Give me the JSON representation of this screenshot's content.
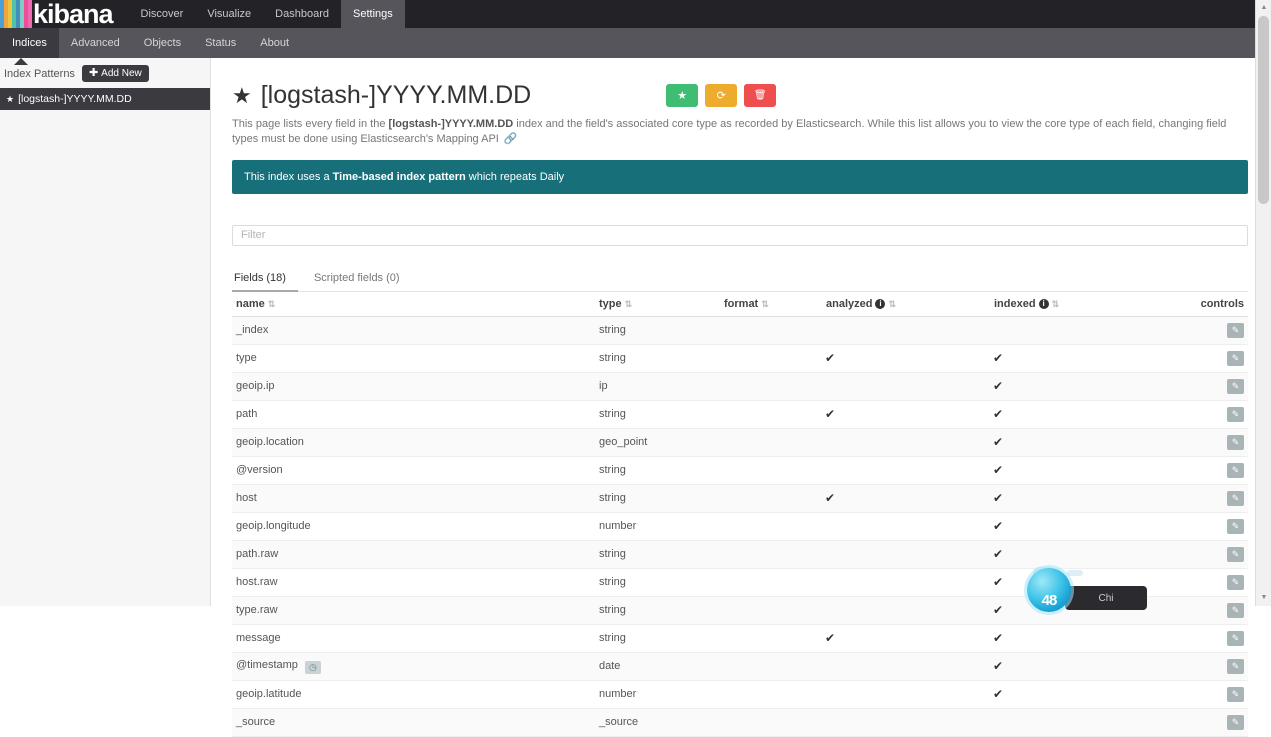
{
  "topnav": {
    "logo_text": "kibana",
    "logo_bar_colors": [
      "#4b9fd5",
      "#f2a33c",
      "#eac73e",
      "#55c1a9",
      "#3f8fbd",
      "#7ecfc0",
      "#ee4d9b",
      "#f06ab0"
    ],
    "items": [
      {
        "label": "Discover",
        "active": false
      },
      {
        "label": "Visualize",
        "active": false
      },
      {
        "label": "Dashboard",
        "active": false
      },
      {
        "label": "Settings",
        "active": true
      }
    ]
  },
  "subnav": {
    "items": [
      {
        "label": "Indices",
        "active": true
      },
      {
        "label": "Advanced",
        "active": false
      },
      {
        "label": "Objects",
        "active": false
      },
      {
        "label": "Status",
        "active": false
      },
      {
        "label": "About",
        "active": false
      }
    ]
  },
  "sidebar": {
    "heading": "Index Patterns",
    "add_new_label": "Add New",
    "add_new_icon": "plus-icon",
    "patterns": [
      {
        "label": "[logstash-]YYYY.MM.DD",
        "icon": "star-icon",
        "active": true
      }
    ]
  },
  "header": {
    "star_icon": "star-icon",
    "title": "[logstash-]YYYY.MM.DD",
    "actions": [
      {
        "name": "set-default-index-button",
        "icon": "★",
        "color": "#3fbe73"
      },
      {
        "name": "refresh-fields-button",
        "icon": "⟳",
        "color": "#eeac2e"
      },
      {
        "name": "delete-index-pattern-button",
        "icon": "🗑",
        "color": "#ef4e4e"
      }
    ],
    "description_pre": "This page lists every field in the ",
    "description_bold": "[logstash-]YYYY.MM.DD",
    "description_post": " index and the field's associated core type as recorded by Elasticsearch. While this list allows you to view the core type of each field, changing field types must be done using Elasticsearch's Mapping API ",
    "description_link_icon": "chain-icon",
    "alert_pre": "This index uses a ",
    "alert_bold": "Time-based index pattern",
    "alert_post": " which repeats Daily"
  },
  "filter": {
    "placeholder": "Filter",
    "value": ""
  },
  "tabs": [
    {
      "label": "Fields (18)",
      "active": true
    },
    {
      "label": "Scripted fields (0)",
      "active": false
    }
  ],
  "table": {
    "columns": [
      {
        "label": "name",
        "sortable": true,
        "info": false
      },
      {
        "label": "type",
        "sortable": true,
        "info": false
      },
      {
        "label": "format",
        "sortable": true,
        "info": false
      },
      {
        "label": "analyzed",
        "sortable": true,
        "info": true
      },
      {
        "label": "indexed",
        "sortable": true,
        "info": true
      },
      {
        "label": "controls",
        "sortable": false,
        "info": false
      }
    ],
    "check_glyph": "✔",
    "edit_icon": "✎",
    "rows": [
      {
        "name": "_index",
        "type": "string",
        "format": "",
        "analyzed": false,
        "indexed": false,
        "badge": null
      },
      {
        "name": "type",
        "type": "string",
        "format": "",
        "analyzed": true,
        "indexed": true,
        "badge": null
      },
      {
        "name": "geoip.ip",
        "type": "ip",
        "format": "",
        "analyzed": false,
        "indexed": true,
        "badge": null
      },
      {
        "name": "path",
        "type": "string",
        "format": "",
        "analyzed": true,
        "indexed": true,
        "badge": null
      },
      {
        "name": "geoip.location",
        "type": "geo_point",
        "format": "",
        "analyzed": false,
        "indexed": true,
        "badge": null
      },
      {
        "name": "@version",
        "type": "string",
        "format": "",
        "analyzed": false,
        "indexed": true,
        "badge": null
      },
      {
        "name": "host",
        "type": "string",
        "format": "",
        "analyzed": true,
        "indexed": true,
        "badge": null
      },
      {
        "name": "geoip.longitude",
        "type": "number",
        "format": "",
        "analyzed": false,
        "indexed": true,
        "badge": null
      },
      {
        "name": "path.raw",
        "type": "string",
        "format": "",
        "analyzed": false,
        "indexed": true,
        "badge": null
      },
      {
        "name": "host.raw",
        "type": "string",
        "format": "",
        "analyzed": false,
        "indexed": true,
        "badge": null
      },
      {
        "name": "type.raw",
        "type": "string",
        "format": "",
        "analyzed": false,
        "indexed": true,
        "badge": null
      },
      {
        "name": "message",
        "type": "string",
        "format": "",
        "analyzed": true,
        "indexed": true,
        "badge": null
      },
      {
        "name": "@timestamp",
        "type": "date",
        "format": "",
        "analyzed": false,
        "indexed": true,
        "badge": "clock-icon"
      },
      {
        "name": "geoip.latitude",
        "type": "number",
        "format": "",
        "analyzed": false,
        "indexed": true,
        "badge": null
      },
      {
        "name": "_source",
        "type": "_source",
        "format": "",
        "analyzed": false,
        "indexed": false,
        "badge": null
      }
    ]
  },
  "overlay": {
    "temperature": "48",
    "label": "Chi"
  }
}
